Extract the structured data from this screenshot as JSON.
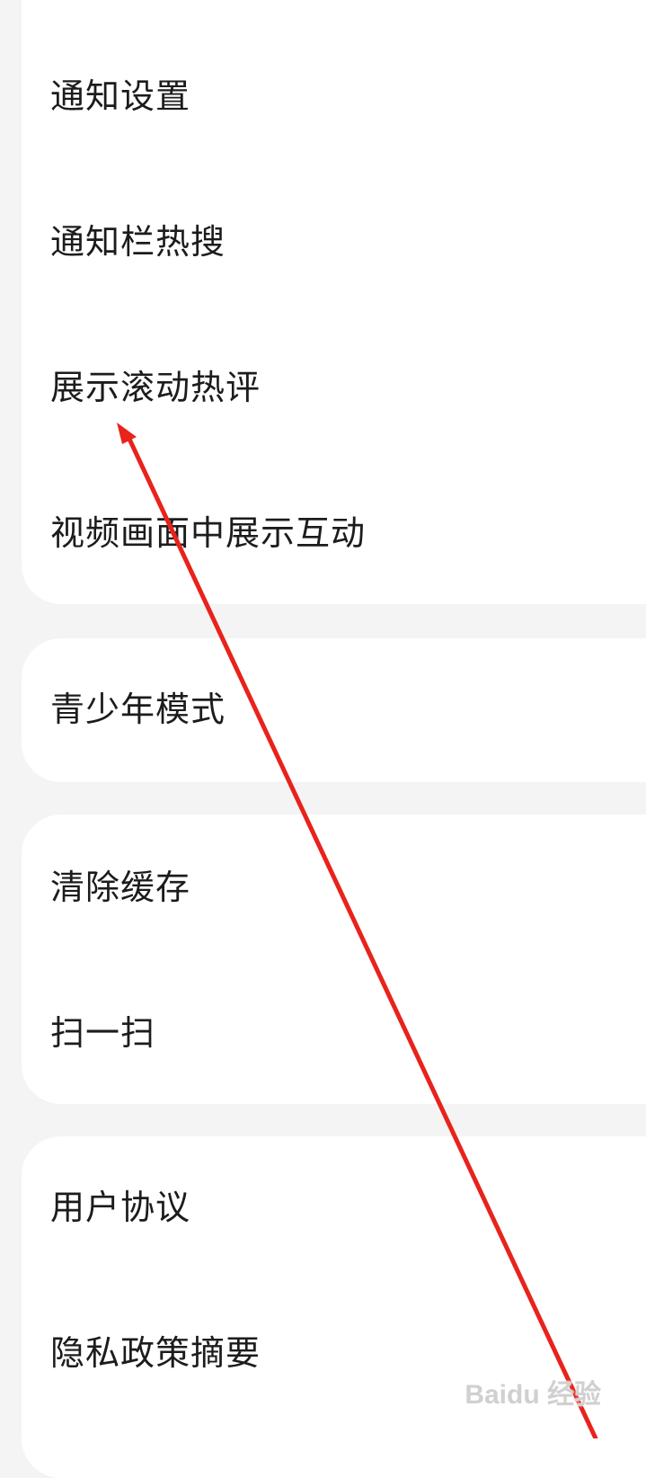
{
  "settings_groups": [
    {
      "items": [
        {
          "label": "通知设置"
        },
        {
          "label": "通知栏热搜"
        },
        {
          "label": "展示滚动热评"
        },
        {
          "label": "视频画面中展示互动"
        }
      ]
    },
    {
      "items": [
        {
          "label": "青少年模式"
        }
      ]
    },
    {
      "items": [
        {
          "label": "清除缓存"
        },
        {
          "label": "扫一扫"
        }
      ]
    },
    {
      "items": [
        {
          "label": "用户协议"
        },
        {
          "label": "隐私政策摘要"
        }
      ]
    }
  ],
  "annotation": {
    "type": "arrow",
    "color": "#e8231c"
  },
  "watermark": {
    "text": "Baidu 经验",
    "icon": "paw-icon"
  },
  "colors": {
    "page_background": "#f4f4f4",
    "card_background": "#ffffff",
    "text": "#1c1c1c"
  }
}
